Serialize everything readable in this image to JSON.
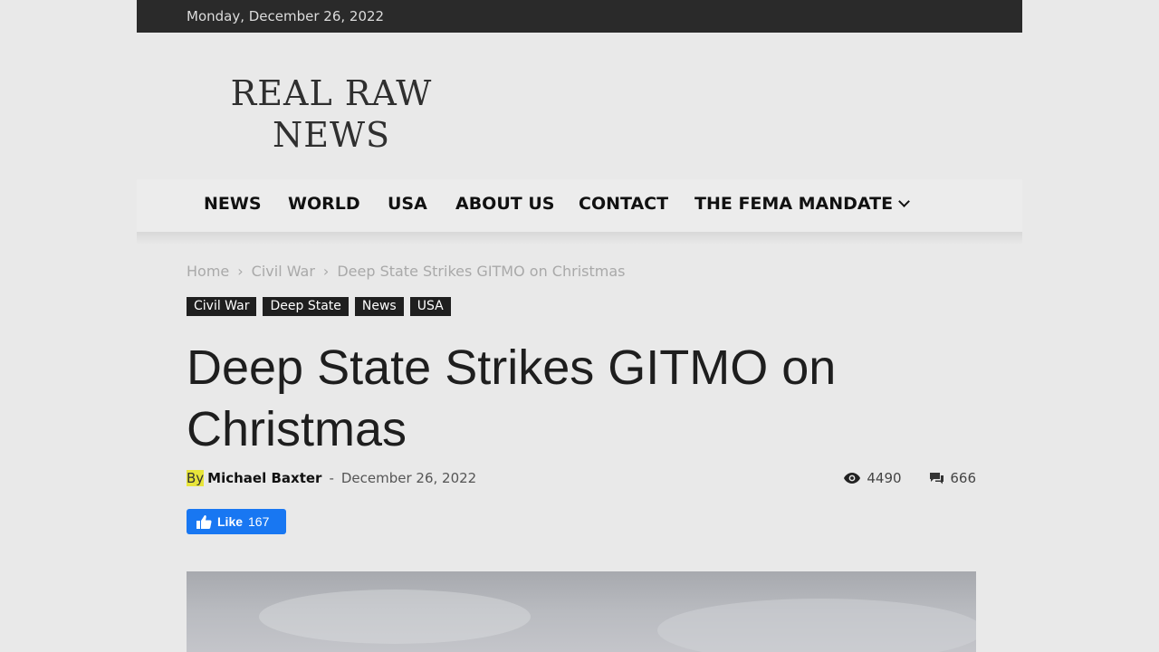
{
  "topbar": {
    "date": "Monday, December 26, 2022"
  },
  "logo": {
    "line1": "REAL RAW",
    "line2": "NEWS"
  },
  "nav": {
    "items": [
      "NEWS",
      "WORLD",
      "USA",
      "ABOUT US",
      "CONTACT",
      "THE FEMA MANDATE"
    ]
  },
  "breadcrumb": {
    "home": "Home",
    "category": "Civil War",
    "current": "Deep State Strikes GITMO on Christmas",
    "separator": "›"
  },
  "tags": [
    "Civil War",
    "Deep State",
    "News",
    "USA"
  ],
  "article": {
    "title": "Deep State Strikes GITMO on Christmas",
    "by_label": "By",
    "author": "Michael Baxter",
    "dash": "-",
    "date": "December 26, 2022",
    "views": "4490",
    "comments": "666"
  },
  "like": {
    "label": "Like",
    "count": "167",
    "color": "#1877f2"
  },
  "icons": {
    "views": "eye-icon",
    "comments": "comment-icon",
    "like": "thumbs-up-icon",
    "dropdown": "chevron-down-icon"
  }
}
